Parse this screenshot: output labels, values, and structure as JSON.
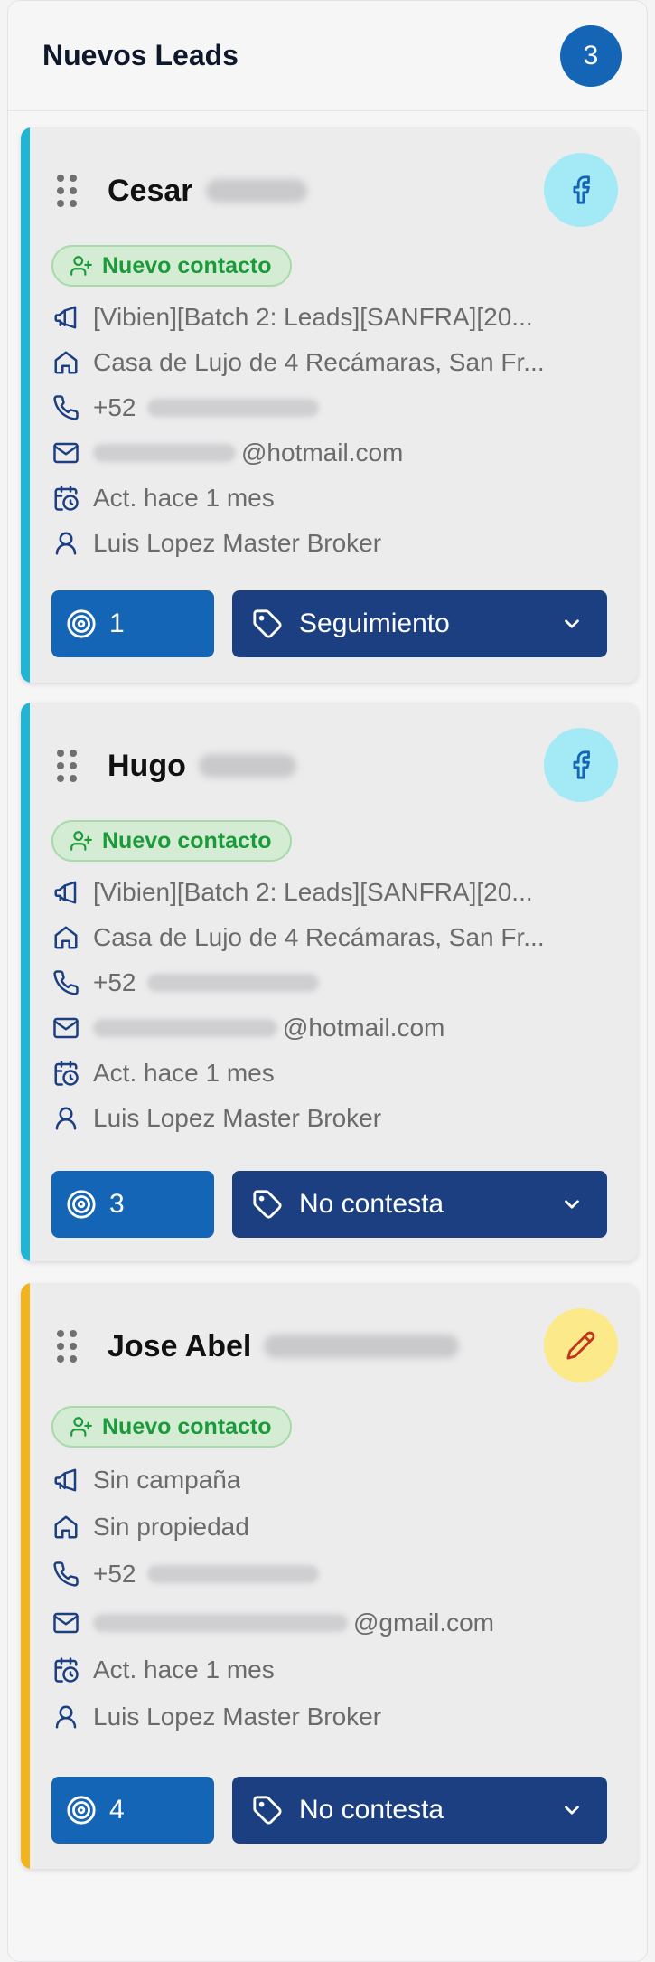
{
  "column": {
    "title": "Nuevos Leads",
    "count": "3"
  },
  "colors": {
    "facebook_stripe": "#1fb6d6",
    "manual_stripe": "#f2b41b",
    "badge": "#1565b6",
    "status_button": "#1b3f80"
  },
  "leads": [
    {
      "first_name": "Cesar",
      "source_icon": "facebook-icon",
      "tag": "Nuevo contacto",
      "campaign": "[Vibien][Batch 2: Leads][SANFRA][20...",
      "property": "Casa de Lujo de 4 Recámaras, San Fr...",
      "phone_prefix": "+52",
      "email_domain": "@hotmail.com",
      "updated": "Act. hace 1 mes",
      "agent": "Luis Lopez Master Broker",
      "interactions": "1",
      "status": "Seguimiento"
    },
    {
      "first_name": "Hugo",
      "source_icon": "facebook-icon",
      "tag": "Nuevo contacto",
      "campaign": "[Vibien][Batch 2: Leads][SANFRA][20...",
      "property": "Casa de Lujo de 4 Recámaras, San Fr...",
      "phone_prefix": "+52",
      "email_domain": "@hotmail.com",
      "updated": "Act. hace 1 mes",
      "agent": "Luis Lopez Master Broker",
      "interactions": "3",
      "status": "No contesta"
    },
    {
      "first_name": "Jose Abel",
      "source_icon": "pencil-icon",
      "tag": "Nuevo contacto",
      "campaign": "Sin campaña",
      "property": "Sin propiedad",
      "phone_prefix": "+52",
      "email_domain": "@gmail.com",
      "updated": "Act. hace 1 mes",
      "agent": "Luis Lopez Master Broker",
      "interactions": "4",
      "status": "No contesta"
    }
  ]
}
